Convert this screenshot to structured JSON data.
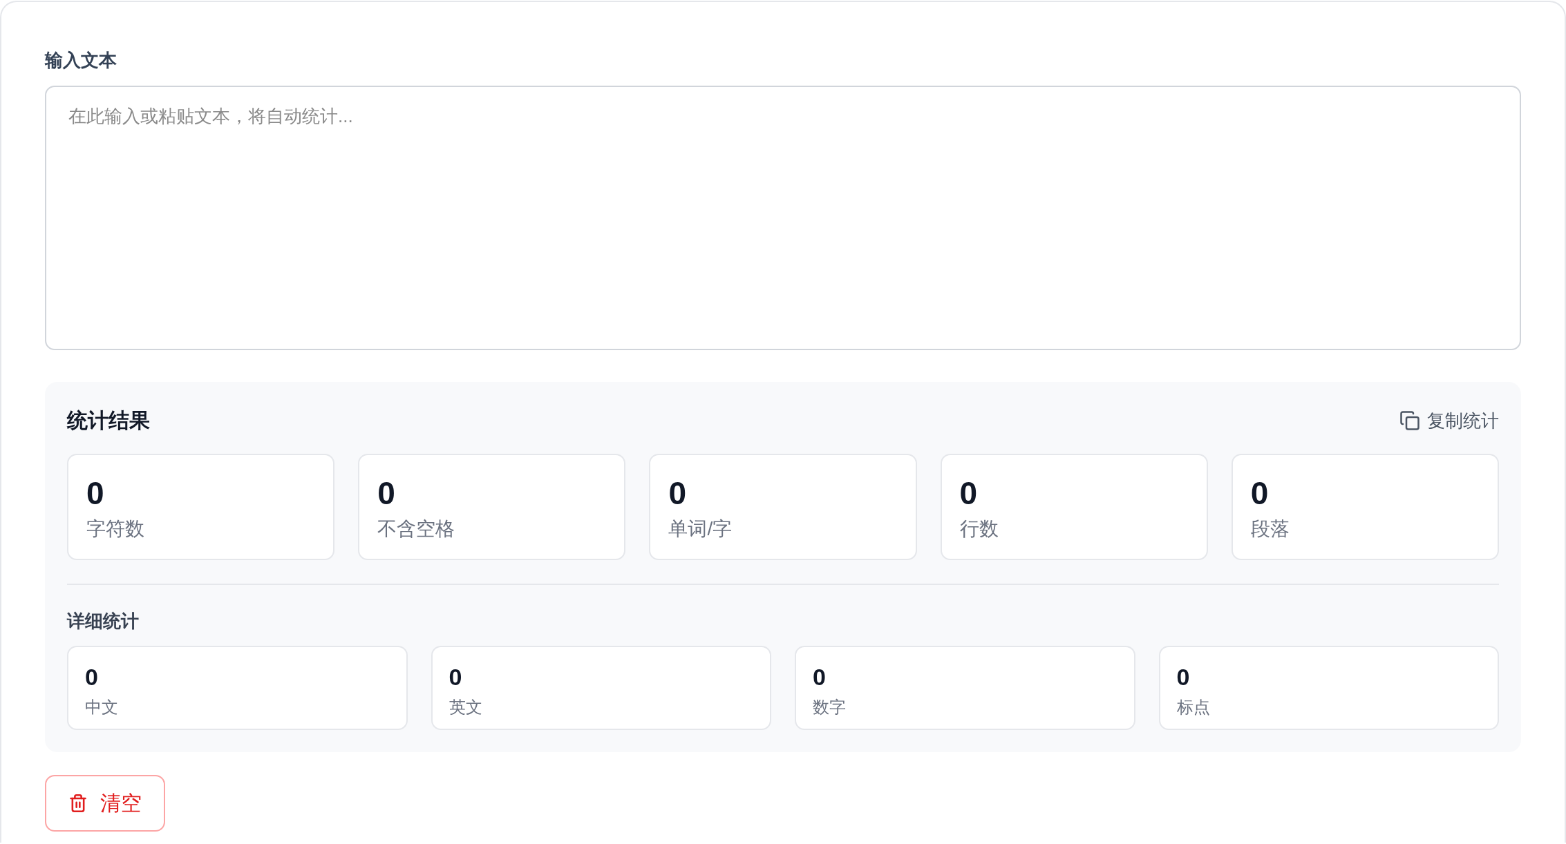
{
  "input": {
    "label": "输入文本",
    "placeholder": "在此输入或粘贴文本，将自动统计..."
  },
  "results": {
    "title": "统计结果",
    "copy_button": "复制统计",
    "stats": [
      {
        "value": "0",
        "label": "字符数"
      },
      {
        "value": "0",
        "label": "不含空格"
      },
      {
        "value": "0",
        "label": "单词/字"
      },
      {
        "value": "0",
        "label": "行数"
      },
      {
        "value": "0",
        "label": "段落"
      }
    ]
  },
  "details": {
    "title": "详细统计",
    "stats": [
      {
        "value": "0",
        "label": "中文"
      },
      {
        "value": "0",
        "label": "英文"
      },
      {
        "value": "0",
        "label": "数字"
      },
      {
        "value": "0",
        "label": "标点"
      }
    ]
  },
  "clear_button": "清空"
}
